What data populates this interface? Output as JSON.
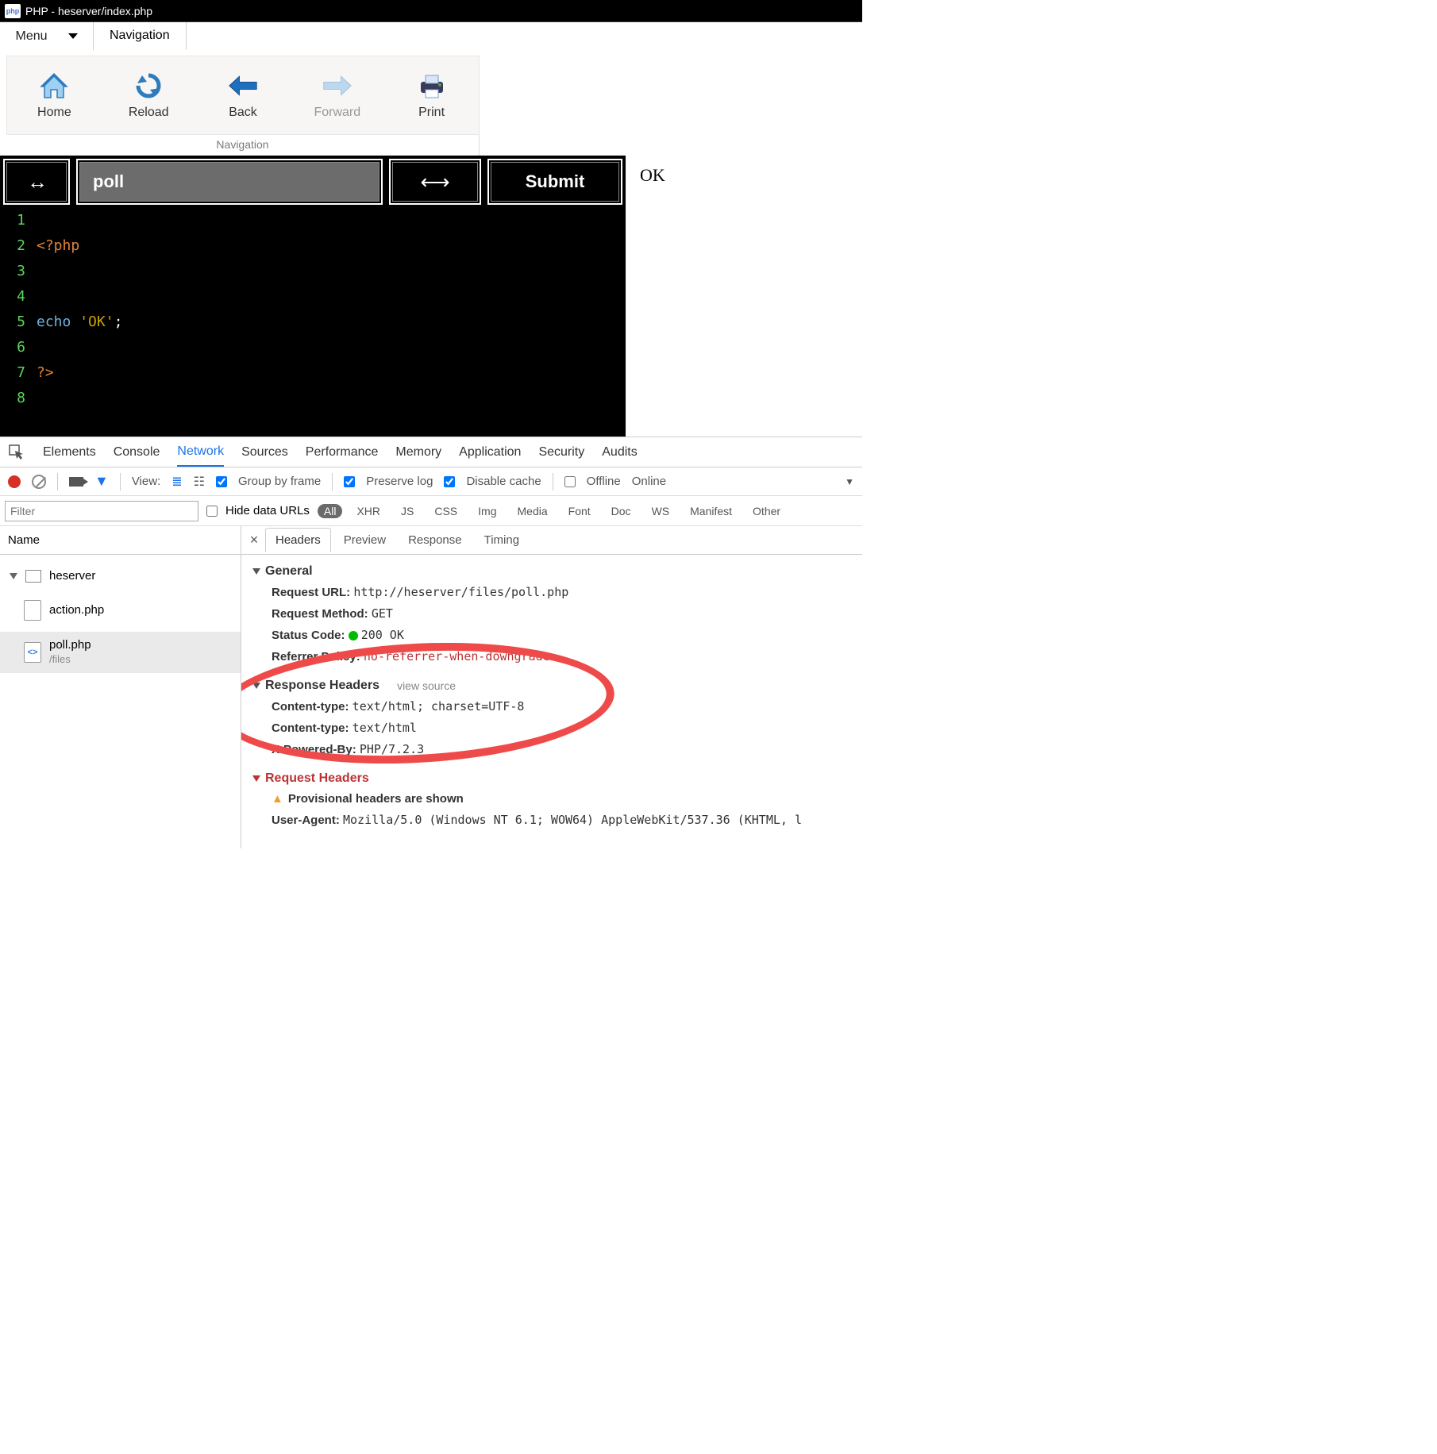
{
  "title": "PHP - heserver/index.php",
  "icon_label": "php",
  "menu": {
    "menu_label": "Menu",
    "nav_label": "Navigation"
  },
  "ribbon": {
    "caption": "Navigation",
    "items": {
      "home": "Home",
      "reload": "Reload",
      "back": "Back",
      "forward": "Forward",
      "print": "Print"
    }
  },
  "editor_bar": {
    "title": "poll",
    "submit": "Submit"
  },
  "code": {
    "lines": [
      "1",
      "2",
      "3",
      "4",
      "5",
      "6",
      "7",
      "8"
    ],
    "l1": "<?php",
    "l4_kw": "echo",
    "l4_str": "'OK'",
    "l4_pun": ";",
    "l6": "?>"
  },
  "output": "OK",
  "devtools": {
    "tabs": {
      "elements": "Elements",
      "console": "Console",
      "network": "Network",
      "sources": "Sources",
      "performance": "Performance",
      "memory": "Memory",
      "application": "Application",
      "security": "Security",
      "audits": "Audits"
    },
    "toolbar": {
      "view": "View:",
      "group": "Group by frame",
      "preserve": "Preserve log",
      "disable": "Disable cache",
      "offline": "Offline",
      "online": "Online"
    },
    "filterbar": {
      "placeholder": "Filter",
      "hide": "Hide data URLs",
      "types": {
        "all": "All",
        "xhr": "XHR",
        "js": "JS",
        "css": "CSS",
        "img": "Img",
        "media": "Media",
        "font": "Font",
        "doc": "Doc",
        "ws": "WS",
        "manifest": "Manifest",
        "other": "Other"
      }
    },
    "tree": {
      "head": "Name",
      "root": "heserver",
      "files": [
        {
          "name": "action.php",
          "sub": ""
        },
        {
          "name": "poll.php",
          "sub": "/files"
        }
      ]
    },
    "detail_tabs": {
      "headers": "Headers",
      "preview": "Preview",
      "response": "Response",
      "timing": "Timing"
    },
    "headers": {
      "general_title": "General",
      "req_url_l": "Request URL:",
      "req_url_v": "http://heserver/files/poll.php",
      "req_method_l": "Request Method:",
      "req_method_v": "GET",
      "status_l": "Status Code:",
      "status_v": "200 OK",
      "ref_l": "Referrer Policy:",
      "ref_v": "no-referrer-when-downgrade",
      "resp_title": "Response Headers",
      "view_source": "view source",
      "ct1_l": "Content-type:",
      "ct1_v": "text/html; charset=UTF-8",
      "ct2_l": "Content-type:",
      "ct2_v": "text/html",
      "xpb_l": "X-Powered-By:",
      "xpb_v": "PHP/7.2.3",
      "reqh_title": "Request Headers",
      "prov": "Provisional headers are shown",
      "ua_l": "User-Agent:",
      "ua_v": "Mozilla/5.0 (Windows NT 6.1; WOW64) AppleWebKit/537.36 (KHTML, l"
    }
  }
}
